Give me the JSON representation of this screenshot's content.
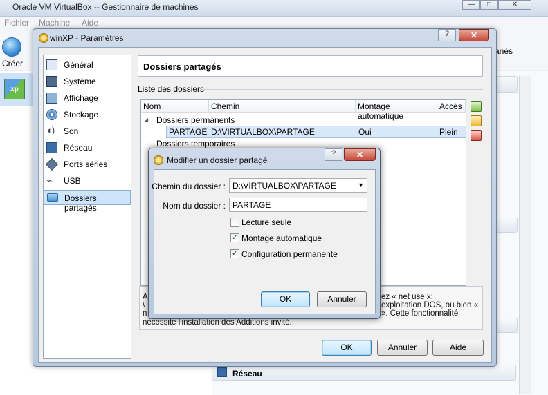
{
  "main": {
    "title": "Oracle VM VirtualBox -- Gestionnaire de machines",
    "menu": [
      "Fichier",
      "Machine",
      "Aide"
    ],
    "toolbar_creer": "Créer",
    "partial_right_label": "anés",
    "vm_icon_text": "xp",
    "section_reseau": "Réseau"
  },
  "settings": {
    "title": "winXP - Paramètres",
    "help": "?",
    "close": "✕",
    "categories": [
      {
        "label": "Général",
        "icon": "monitor-icon"
      },
      {
        "label": "Système",
        "icon": "chip-icon"
      },
      {
        "label": "Affichage",
        "icon": "display-icon"
      },
      {
        "label": "Stockage",
        "icon": "disk-icon"
      },
      {
        "label": "Son",
        "icon": "speaker-icon"
      },
      {
        "label": "Réseau",
        "icon": "network-icon"
      },
      {
        "label": "Ports séries",
        "icon": "port-icon"
      },
      {
        "label": "USB",
        "icon": "usb-icon"
      },
      {
        "label": "Dossiers partagés",
        "icon": "folder-icon"
      }
    ],
    "page_title": "Dossiers partagés",
    "list_caption": "Liste des dossiers",
    "columns": [
      "Nom",
      "Chemin",
      "Montage automatique",
      "Accès"
    ],
    "group_permanent": "Dossiers permanents",
    "row": {
      "name": "PARTAGE",
      "path": "D:\\VIRTUALBOX\\PARTAGE",
      "auto": "Oui",
      "access": "Plein"
    },
    "group_temporary": "Dossiers temporaires",
    "info": {
      "left_line1": "A",
      "left_line2": "\\",
      "left_line3": "n",
      "right_line1": "ez « net use x:",
      "right_line2": "exploitation DOS, ou bien «",
      "right_line3": "». Cette fonctionnalité",
      "line4": "nécessite l'installation des Additions invité."
    },
    "buttons": {
      "ok": "OK",
      "cancel": "Annuler",
      "help": "Aide"
    }
  },
  "edit_dialog": {
    "title": "Modifier un dossier partagé",
    "help": "?",
    "close": "✕",
    "path_label": "Chemin du dossier :",
    "path_value": "D:\\VIRTUALBOX\\PARTAGE",
    "name_label": "Nom du dossier :",
    "name_value": "PARTAGE",
    "readonly_label": "Lecture seule",
    "readonly_checked": false,
    "automount_label": "Montage automatique",
    "automount_checked": true,
    "permanent_label": "Configuration permanente",
    "permanent_checked": true,
    "check_mark": "✓",
    "ok": "OK",
    "cancel": "Annuler"
  }
}
